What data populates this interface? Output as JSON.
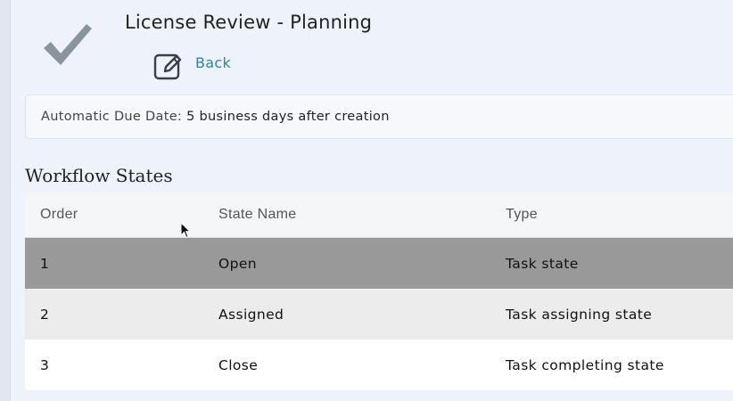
{
  "header": {
    "title": "License Review - Planning",
    "back_label": "Back"
  },
  "due_date": {
    "label": "Automatic Due Date:",
    "value": "5 business days after creation"
  },
  "workflow": {
    "title": "Workflow States",
    "columns": {
      "order": "Order",
      "state_name": "State Name",
      "type": "Type"
    },
    "rows": [
      {
        "order": "1",
        "state_name": "Open",
        "type": "Task state"
      },
      {
        "order": "2",
        "state_name": "Assigned",
        "type": "Task assigning state"
      },
      {
        "order": "3",
        "state_name": "Close",
        "type": "Task completing state"
      }
    ]
  },
  "icons": {
    "check": "checkmark-icon",
    "edit": "edit-icon",
    "cursor": "mouse-pointer-icon"
  },
  "colors": {
    "link": "#2a86a7",
    "selected_row": "#999999",
    "hover_row": "#ececec"
  }
}
